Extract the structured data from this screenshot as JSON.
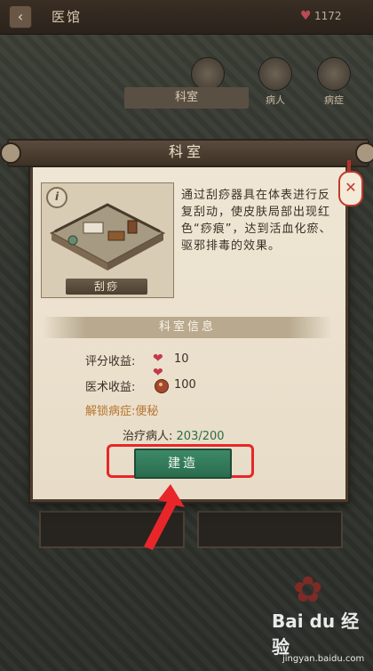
{
  "top_bar": {
    "title": "医馆",
    "count": "1172"
  },
  "side_tabs": [
    {
      "label": "科室"
    },
    {
      "label": "病人"
    },
    {
      "label": "病症"
    }
  ],
  "background_strip": {
    "label": "科室"
  },
  "modal": {
    "title": "科室",
    "room_name": "刮痧",
    "description": "通过刮痧器具在体表进行反复刮动，使皮肤局部出现红色“痧痕”，达到活血化瘀、驱邪排毒的效果。",
    "section_title": "科室信息",
    "stats": {
      "rating_label": "评分收益:",
      "rating_value": "10",
      "medical_label": "医术收益:",
      "medical_value": "100"
    },
    "unlock_text": "解锁病症:便秘",
    "patients_label": "治疗病人:",
    "patients_value": "203/200",
    "build_button": "建造"
  },
  "icons": {
    "info": "i",
    "close": "✕",
    "back": "‹",
    "heart": "♥"
  },
  "colors": {
    "build_button": "#2a6b4e",
    "highlight": "#e8262a",
    "unlock_text": "#b8742f"
  },
  "watermark": {
    "brand": "Bai du 经验",
    "url": "jingyan.baidu.com"
  }
}
